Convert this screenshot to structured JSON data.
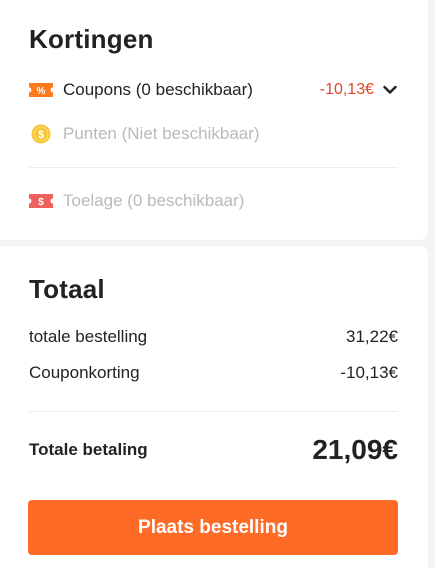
{
  "discounts": {
    "title": "Kortingen",
    "coupons": {
      "label": "Coupons (0 beschikbaar)",
      "amount": "-10,13€",
      "icon": "percent-coupon-icon",
      "icon_text": "%"
    },
    "points": {
      "label": "Punten (Niet beschikbaar)",
      "icon": "coin-icon",
      "icon_text": "$"
    },
    "allowance": {
      "label": "Toelage (0 beschikbaar)",
      "icon": "allowance-ticket-icon",
      "icon_text": "$"
    }
  },
  "total": {
    "title": "Totaal",
    "rows": [
      {
        "label": "totale bestelling",
        "value": "31,22€"
      },
      {
        "label": "Couponkorting",
        "value": "-10,13€"
      }
    ],
    "grand_label": "Totale betaling",
    "grand_value": "21,09€"
  },
  "place_order_label": "Plaats bestelling",
  "colors": {
    "accent": "#fe6b26",
    "discount_red": "#e8412c",
    "coupon_icon": "#ff7a1c",
    "coin_icon": "#f7c531",
    "allowance_icon": "#f0615d",
    "disabled_text": "#b9b9be"
  }
}
